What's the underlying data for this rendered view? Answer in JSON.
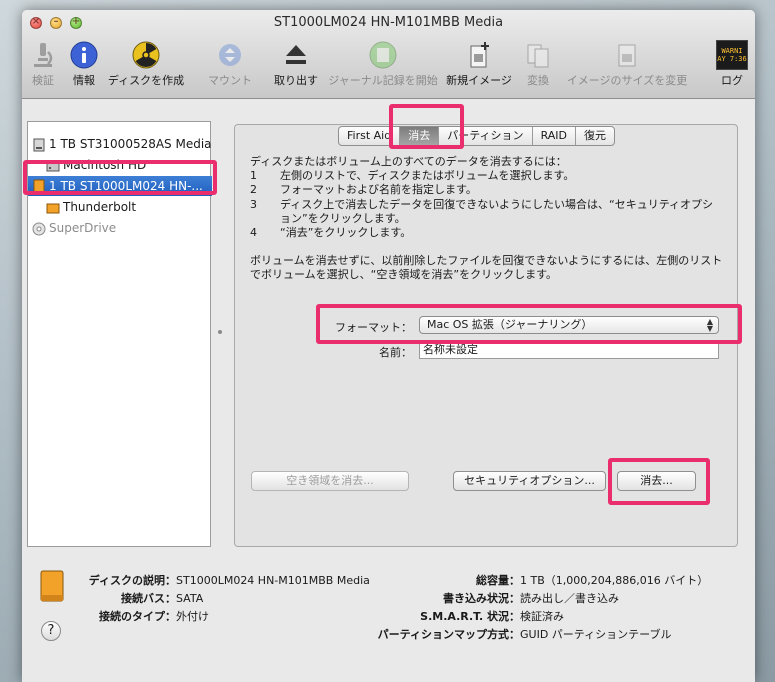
{
  "window": {
    "title": "ST1000LM024 HN-M101MBB Media"
  },
  "toolbar": {
    "items": [
      {
        "label": "検証",
        "icon": "microscope-icon",
        "enabled": false
      },
      {
        "label": "情報",
        "icon": "info-icon",
        "enabled": true
      },
      {
        "label": "ディスクを作成",
        "icon": "burn-icon",
        "enabled": true
      },
      {
        "label": "マウント",
        "icon": "mount-icon",
        "enabled": false
      },
      {
        "label": "取り出す",
        "icon": "eject-icon",
        "enabled": true
      },
      {
        "label": "ジャーナル記録を開始",
        "icon": "journal-icon",
        "enabled": false
      },
      {
        "label": "新規イメージ",
        "icon": "new-image-icon",
        "enabled": true
      },
      {
        "label": "変換",
        "icon": "convert-icon",
        "enabled": false
      },
      {
        "label": "イメージのサイズを変更",
        "icon": "resize-image-icon",
        "enabled": false
      },
      {
        "label": "ログ",
        "icon": "log-icon",
        "enabled": true,
        "display": "WARNI\nAY 7:36"
      }
    ]
  },
  "sidebar": {
    "items": [
      {
        "label": "1 TB ST31000528AS Media",
        "icon": "internal-disk-icon",
        "indent": false
      },
      {
        "label": "Macintosh HD",
        "icon": "volume-icon",
        "indent": true
      },
      {
        "label": "1 TB ST1000LM024 HN-...",
        "icon": "external-disk-icon",
        "indent": false,
        "selected": true
      },
      {
        "label": "Thunderbolt",
        "icon": "volume-icon",
        "indent": true
      },
      {
        "label": "SuperDrive",
        "icon": "optical-drive-icon",
        "indent": false,
        "dim": true
      }
    ]
  },
  "tabs": [
    {
      "label": "First Aid"
    },
    {
      "label": "消去",
      "active": true
    },
    {
      "label": "パーティション"
    },
    {
      "label": "RAID"
    },
    {
      "label": "復元"
    }
  ],
  "erase": {
    "intro": "ディスクまたはボリューム上のすべてのデータを消去するには：",
    "steps": [
      {
        "num": "1",
        "text": "左側のリストで、ディスクまたはボリュームを選択します。"
      },
      {
        "num": "2",
        "text": "フォーマットおよび名前を指定します。"
      },
      {
        "num": "3",
        "text": "ディスク上で消去したデータを回復できないようにしたい場合は、“セキュリティオプシ"
      },
      {
        "num": "",
        "text": "ョン”をクリックします。"
      },
      {
        "num": "4",
        "text": "“消去”をクリックします。"
      }
    ],
    "free_space_line1": "ボリュームを消去せずに、以前削除したファイルを回復できないようにするには、左側のリスト",
    "free_space_line2": "でボリュームを選択し、“空き領域を消去”をクリックします。",
    "format_label": "フォーマット：",
    "format_value": "Mac OS 拡張（ジャーナリング）",
    "name_label": "名前：",
    "name_value": "名称未設定",
    "erase_free_space_button": "空き領域を消去...",
    "security_options_button": "セキュリティオプション...",
    "erase_button": "消去..."
  },
  "info": {
    "left": [
      {
        "key": "ディスクの説明：",
        "value": "ST1000LM024 HN-M101MBB Media"
      },
      {
        "key": "接続バス：",
        "value": "SATA"
      },
      {
        "key": "接続のタイプ：",
        "value": "外付け"
      }
    ],
    "right": [
      {
        "key": "総容量：",
        "value": "1 TB（1,000,204,886,016 バイト）"
      },
      {
        "key": "書き込み状況：",
        "value": "読み出し／書き込み"
      },
      {
        "key": "S.M.A.R.T. 状況：",
        "value": "検証済み"
      },
      {
        "key": "パーティションマップ方式：",
        "value": "GUID パーティションテーブル"
      }
    ],
    "help_label": "?"
  },
  "colors": {
    "highlight": "#ea2e6d",
    "selection": "#2f6fcc"
  }
}
